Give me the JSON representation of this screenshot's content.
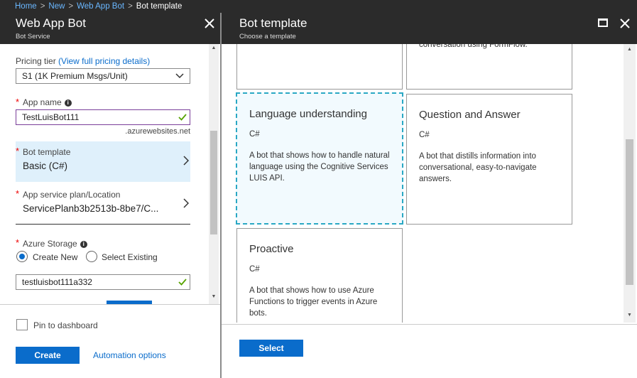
{
  "breadcrumb": {
    "items": [
      "Home",
      "New",
      "Web App Bot"
    ],
    "current": "Bot template",
    "separator": ">"
  },
  "left_blade": {
    "title": "Web App Bot",
    "subtitle": "Bot Service",
    "pricing_tier": {
      "label": "Pricing tier",
      "link_text": "(View full pricing details)",
      "value": "S1 (1K Premium Msgs/Unit)"
    },
    "app_name": {
      "label": "App name",
      "value": "TestLuisBot111",
      "suffix": ".azurewebsites.net"
    },
    "bot_template": {
      "label": "Bot template",
      "value": "Basic (C#)"
    },
    "app_service_plan": {
      "label": "App service plan/Location",
      "value": "ServicePlanb3b2513b-8be7/C..."
    },
    "azure_storage": {
      "label": "Azure Storage",
      "option_create": "Create New",
      "option_select": "Select Existing",
      "selected": "Create New",
      "value": "testluisbot111a332"
    },
    "footer": {
      "pin_label": "Pin to dashboard",
      "pin_checked": false,
      "create_label": "Create",
      "automation_label": "Automation options"
    }
  },
  "right_blade": {
    "title": "Bot template",
    "subtitle": "Choose a template",
    "top_card_partial_text": "conversation using FormFlow.",
    "cards": [
      {
        "title": "Language understanding",
        "language": "C#",
        "description": "A bot that shows how to handle natural language using the Cognitive Services LUIS API.",
        "selected": true
      },
      {
        "title": "Question and Answer",
        "language": "C#",
        "description": "A bot that distills information into conversational, easy-to-navigate answers.",
        "selected": false
      },
      {
        "title": "Proactive",
        "language": "C#",
        "description": "A bot that shows how to use Azure Functions to trigger events in Azure bots.",
        "selected": false
      }
    ],
    "select_label": "Select"
  },
  "colors": {
    "header_bg": "#2b2b2b",
    "accent_blue": "#0a6ccb",
    "link_blue": "#6ab7ff",
    "selected_row_bg": "#dff0fb",
    "selected_card_border": "#2aa8c4",
    "valid_check": "#57a300",
    "required": "#e00000"
  }
}
